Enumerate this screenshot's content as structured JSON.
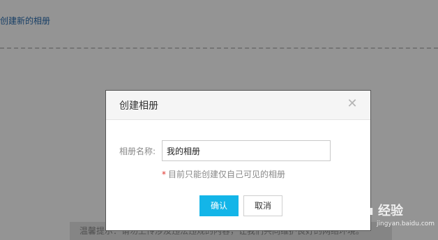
{
  "page": {
    "create_album_link": "创建新的相册",
    "notice_text": "温馨提示：请勿上传涉及违法违规的内容，让我们共同维护良好的网络环境。"
  },
  "dialog": {
    "title": "创建相册",
    "close_icon": "close-icon",
    "name_label": "相册名称:",
    "name_value": "我的相册",
    "hint_asterisk": "*",
    "hint_text": "目前只能创建仅自己可见的相册",
    "confirm_label": "确认",
    "cancel_label": "取消"
  },
  "watermark": {
    "logo_text": "Baidu 经验",
    "url_text": "jingyan.baidu.com"
  },
  "colors": {
    "accent": "#13b5e8",
    "link": "#2a6db0",
    "required": "#e0322b"
  }
}
